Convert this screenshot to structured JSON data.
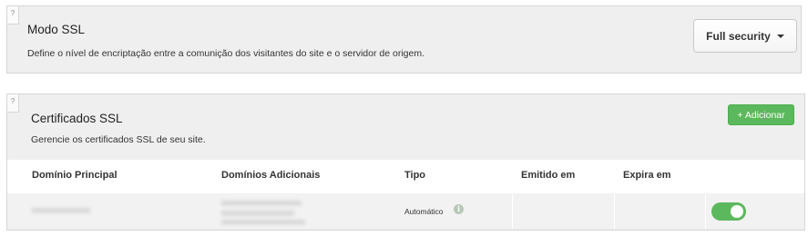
{
  "ssl_mode": {
    "help": "?",
    "title": "Modo SSL",
    "description": "Define o nível de encriptação entre a comunição dos visitantes do site e o servidor de origem.",
    "selected_mode": "Full security"
  },
  "certificates": {
    "help": "?",
    "title": "Certificados SSL",
    "description": "Gerencie os certificados SSL de seu site.",
    "add_label": "+ Adicionar",
    "columns": [
      "Domínio Principal",
      "Domínios Adicionais",
      "Tipo",
      "Emitido em",
      "Expira em"
    ],
    "rows": [
      {
        "primary_domain": "",
        "additional_domains": [],
        "type": "Automático",
        "issued": "",
        "expires": "",
        "enabled": true
      }
    ]
  },
  "colors": {
    "panel_bg": "#efefef",
    "accent_green": "#5cb85c"
  },
  "icons": {
    "info": "info-circle-icon",
    "dropdown": "caret-down-icon"
  }
}
